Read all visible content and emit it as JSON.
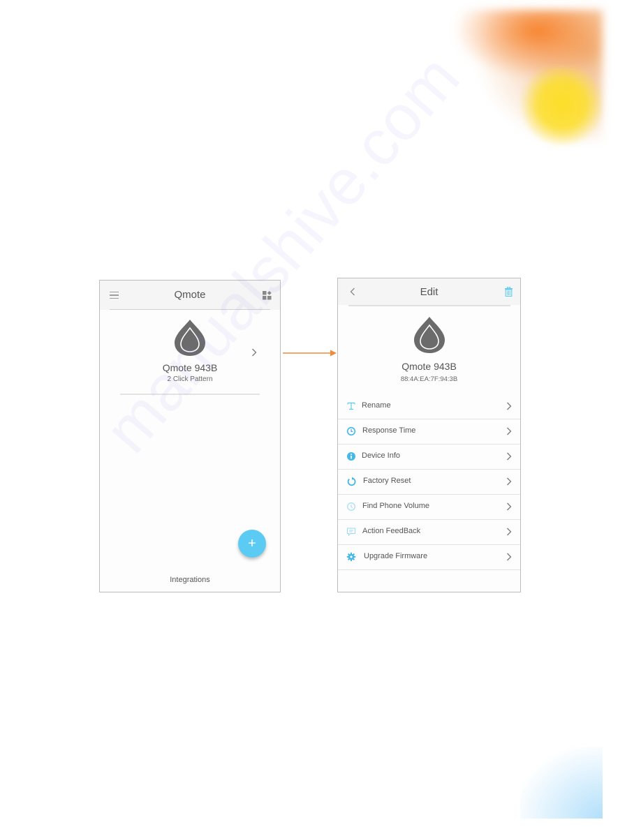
{
  "colors": {
    "accent": "#5ccbf4",
    "arrow": "#f08a3c",
    "icon_gray": "#6b6b6b",
    "text": "#555555"
  },
  "left_screen": {
    "title": "Qmote",
    "menu_icon": "hamburger-menu-icon",
    "right_icon": "dashboard-grid-icon",
    "device": {
      "name": "Qmote 943B",
      "subtitle": "2 Click Pattern",
      "icon": "qmote-drop-icon"
    },
    "fab_label": "+",
    "bottom_label": "Integrations"
  },
  "right_screen": {
    "title": "Edit",
    "back_icon": "chevron-left-icon",
    "delete_icon": "trash-icon",
    "device": {
      "name": "Qmote 943B",
      "mac": "88:4A:EA:7F:94:3B",
      "icon": "qmote-drop-icon"
    },
    "items": [
      {
        "label": "Rename",
        "icon": "text-t-icon"
      },
      {
        "label": "Response Time",
        "icon": "clock-icon"
      },
      {
        "label": "Device Info",
        "icon": "info-icon"
      },
      {
        "label": "Factory Reset",
        "icon": "reset-icon"
      },
      {
        "label": "Find Phone Volume",
        "icon": "volume-clock-icon"
      },
      {
        "label": "Action FeedBack",
        "icon": "chat-bubble-icon"
      },
      {
        "label": "Upgrade Firmware",
        "icon": "gear-icon"
      }
    ]
  },
  "watermark": "manualshive.com"
}
